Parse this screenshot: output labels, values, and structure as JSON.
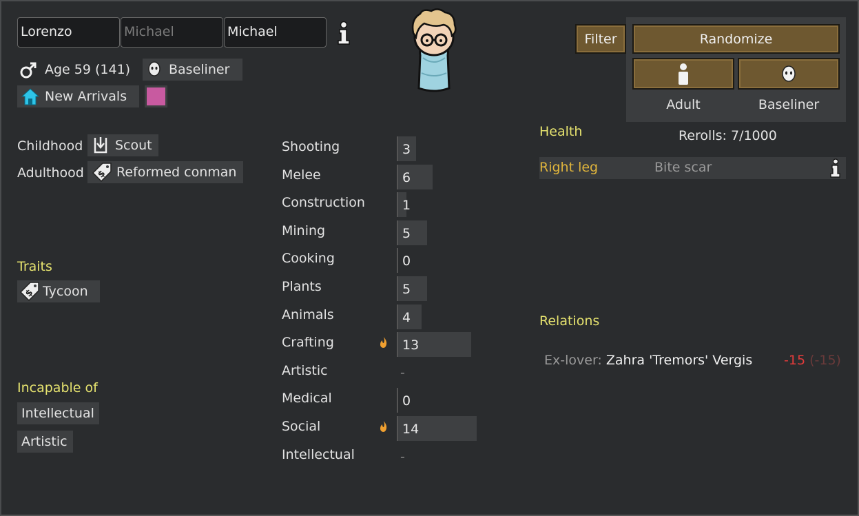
{
  "name": {
    "first": "Lorenzo",
    "nick": "Michael",
    "last": "Michael"
  },
  "age_text": "Age 59 (141)",
  "xenotype": "Baseliner",
  "faction": "New Arrivals",
  "favorite_color": "#c85aa0",
  "backstory": {
    "childhood_label": "Childhood",
    "childhood": "Scout",
    "adulthood_label": "Adulthood",
    "adulthood": "Reformed conman"
  },
  "traits": {
    "header": "Traits",
    "items": [
      "Tycoon"
    ]
  },
  "incapable": {
    "header": "Incapable of",
    "items": [
      "Intellectual",
      "Artistic"
    ]
  },
  "skills": [
    {
      "name": "Shooting",
      "value": "3",
      "level": 3,
      "passion": false
    },
    {
      "name": "Melee",
      "value": "6",
      "level": 6,
      "passion": false
    },
    {
      "name": "Construction",
      "value": "1",
      "level": 1,
      "passion": false
    },
    {
      "name": "Mining",
      "value": "5",
      "level": 5,
      "passion": false
    },
    {
      "name": "Cooking",
      "value": "0",
      "level": 0,
      "passion": false
    },
    {
      "name": "Plants",
      "value": "5",
      "level": 5,
      "passion": false
    },
    {
      "name": "Animals",
      "value": "4",
      "level": 4,
      "passion": false
    },
    {
      "name": "Crafting",
      "value": "13",
      "level": 13,
      "passion": true
    },
    {
      "name": "Artistic",
      "value": "-",
      "level": null,
      "passion": false
    },
    {
      "name": "Medical",
      "value": "0",
      "level": 0,
      "passion": false
    },
    {
      "name": "Social",
      "value": "14",
      "level": 14,
      "passion": true
    },
    {
      "name": "Intellectual",
      "value": "-",
      "level": null,
      "passion": false
    }
  ],
  "controls": {
    "filter": "Filter",
    "randomize": "Randomize",
    "dev_stage": "Adult",
    "xenotype": "Baseliner",
    "rerolls": "Rerolls: 7/1000"
  },
  "health": {
    "header": "Health",
    "rows": [
      {
        "part": "Right leg",
        "condition": "Bite scar"
      }
    ]
  },
  "relations": {
    "header": "Relations",
    "rows": [
      {
        "type": "Ex-lover:",
        "name": "Zahra 'Tremors' Vergis",
        "opinion": "-15",
        "opinion_paren": "(-15)"
      }
    ]
  },
  "colors": {
    "background": "#2a2c2e",
    "section_header": "#e6e36f",
    "health_part": "#e0b53c",
    "button_wood": "#6e5830",
    "negative": "#e23b3b",
    "flame": "#f0a030"
  },
  "icons": [
    "male-gender-icon",
    "baseliner-head-icon",
    "faction-house-icon",
    "info-icon",
    "scout-backstory-icon",
    "conman-tag-icon",
    "tycoon-tag-icon",
    "passion-flame-icon",
    "adult-figure-icon"
  ]
}
